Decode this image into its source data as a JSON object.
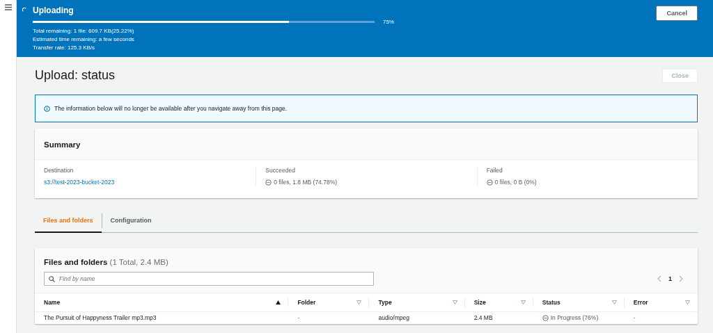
{
  "banner": {
    "title": "Uploading",
    "level": 0.75,
    "percent": "75%",
    "lines": [
      "Total remaining: 1 file: 609.7 KB(25.22%)",
      "Estimated time remaining: a few seconds",
      "Transfer rate: 125.3 KB/s"
    ],
    "cancel": "Cancel"
  },
  "page": {
    "title": "Upload: status",
    "close": {
      "label": "Close",
      "disabled": true
    }
  },
  "alert": "The information below will no longer be available after you navigate away from this page.",
  "summary": {
    "title": "Summary",
    "items": [
      {
        "label": "Destination",
        "value": "s3://test-2023-bucket-2023",
        "kind": "link"
      },
      {
        "label": "Succeeded",
        "value": "0 files, 1.8 MB (74.78%)",
        "kind": "status"
      },
      {
        "label": "Failed",
        "value": "0 files, 0 B (0%)",
        "kind": "status"
      }
    ]
  },
  "tabs": [
    {
      "label": "Files and folders",
      "selected": true
    },
    {
      "label": "Configuration",
      "selected": false
    }
  ],
  "files": {
    "title": "Files and folders",
    "count": "(1 Total, 2.4 MB)",
    "search": {
      "placeholder": "Find by name"
    },
    "page": "1",
    "columns": [
      {
        "label": "Name",
        "sorted": true
      },
      {
        "label": "Folder",
        "sorted": false
      },
      {
        "label": "Type",
        "sorted": false
      },
      {
        "label": "Size",
        "sorted": false
      },
      {
        "label": "Status",
        "sorted": false
      },
      {
        "label": "Error",
        "sorted": false
      }
    ],
    "rows": [
      [
        "The Pursuit of Happyness Trailer mp3.mp3",
        "-",
        "audio/mpeg",
        "2.4 MB",
        "In Progress (76%)",
        "-"
      ]
    ]
  }
}
